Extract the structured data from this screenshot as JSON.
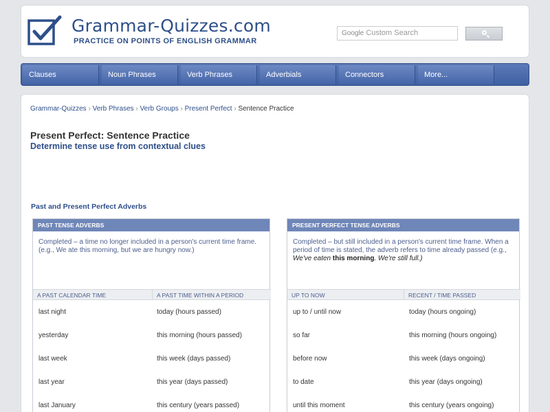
{
  "site": {
    "title": "Grammar-Quizzes.com",
    "tagline": "PRACTICE ON POINTS OF ENGLISH GRAMMAR"
  },
  "search": {
    "brand": "Google",
    "placeholder": "Custom Search"
  },
  "nav": [
    {
      "label": "Clauses"
    },
    {
      "label": "Noun Phrases"
    },
    {
      "label": "Verb Phrases"
    },
    {
      "label": "Adverbials"
    },
    {
      "label": "Connectors"
    },
    {
      "label": "More..."
    }
  ],
  "breadcrumb": {
    "items": [
      "Grammar-Quizzes",
      "Verb Phrases",
      "Verb Groups",
      "Present Perfect"
    ],
    "separator": "›",
    "current": "Sentence Practice"
  },
  "page": {
    "title": "Present Perfect: Sentence Practice",
    "subtitle": "Determine tense use from contextual clues",
    "section_heading": "Past and Present Perfect Adverbs"
  },
  "panels": [
    {
      "header": "PAST TENSE ADVERBS",
      "desc": "Completed – a time no longer included in a person's current time frame. (e.g., We ate this morning, but we are hungry now.)",
      "col1": "A  PAST CALENDAR TIME",
      "col2": "A  PAST TIME WITHIN A PERIOD",
      "rows": [
        [
          "last night",
          "today  (hours passed)"
        ],
        [
          "yesterday",
          "this morning  (hours passed)"
        ],
        [
          "last week",
          "this week (days passed)"
        ],
        [
          "last year",
          "this year  (days passed)"
        ],
        [
          "last January",
          "this century (years passed)"
        ]
      ]
    },
    {
      "header": "PRESENT PERFECT TENSE ADVERBS",
      "desc_a": "Completed – but still included in a person's current time frame. When a period of time is stated, the adverb refers to time already passed (e.g.,",
      "desc_i1": "We've eaten",
      "desc_b": "this morning",
      "desc_i2": ". We're still full.)",
      "col1": "UP TO NOW",
      "col2": "RECENT / TIME PASSED",
      "rows": [
        [
          "up to / until now",
          "today  (hours ongoing)"
        ],
        [
          "so far",
          "this morning  (hours ongoing)"
        ],
        [
          "before now",
          "this week (days ongoing)"
        ],
        [
          "to date",
          "this year  (days ongoing)"
        ],
        [
          "until this moment",
          "this century (years ongoing)"
        ]
      ]
    }
  ],
  "colors": {
    "brand_blue": "#2e4f8a",
    "nav_blue": "#4565a8",
    "panel_header": "#6f86b8"
  }
}
